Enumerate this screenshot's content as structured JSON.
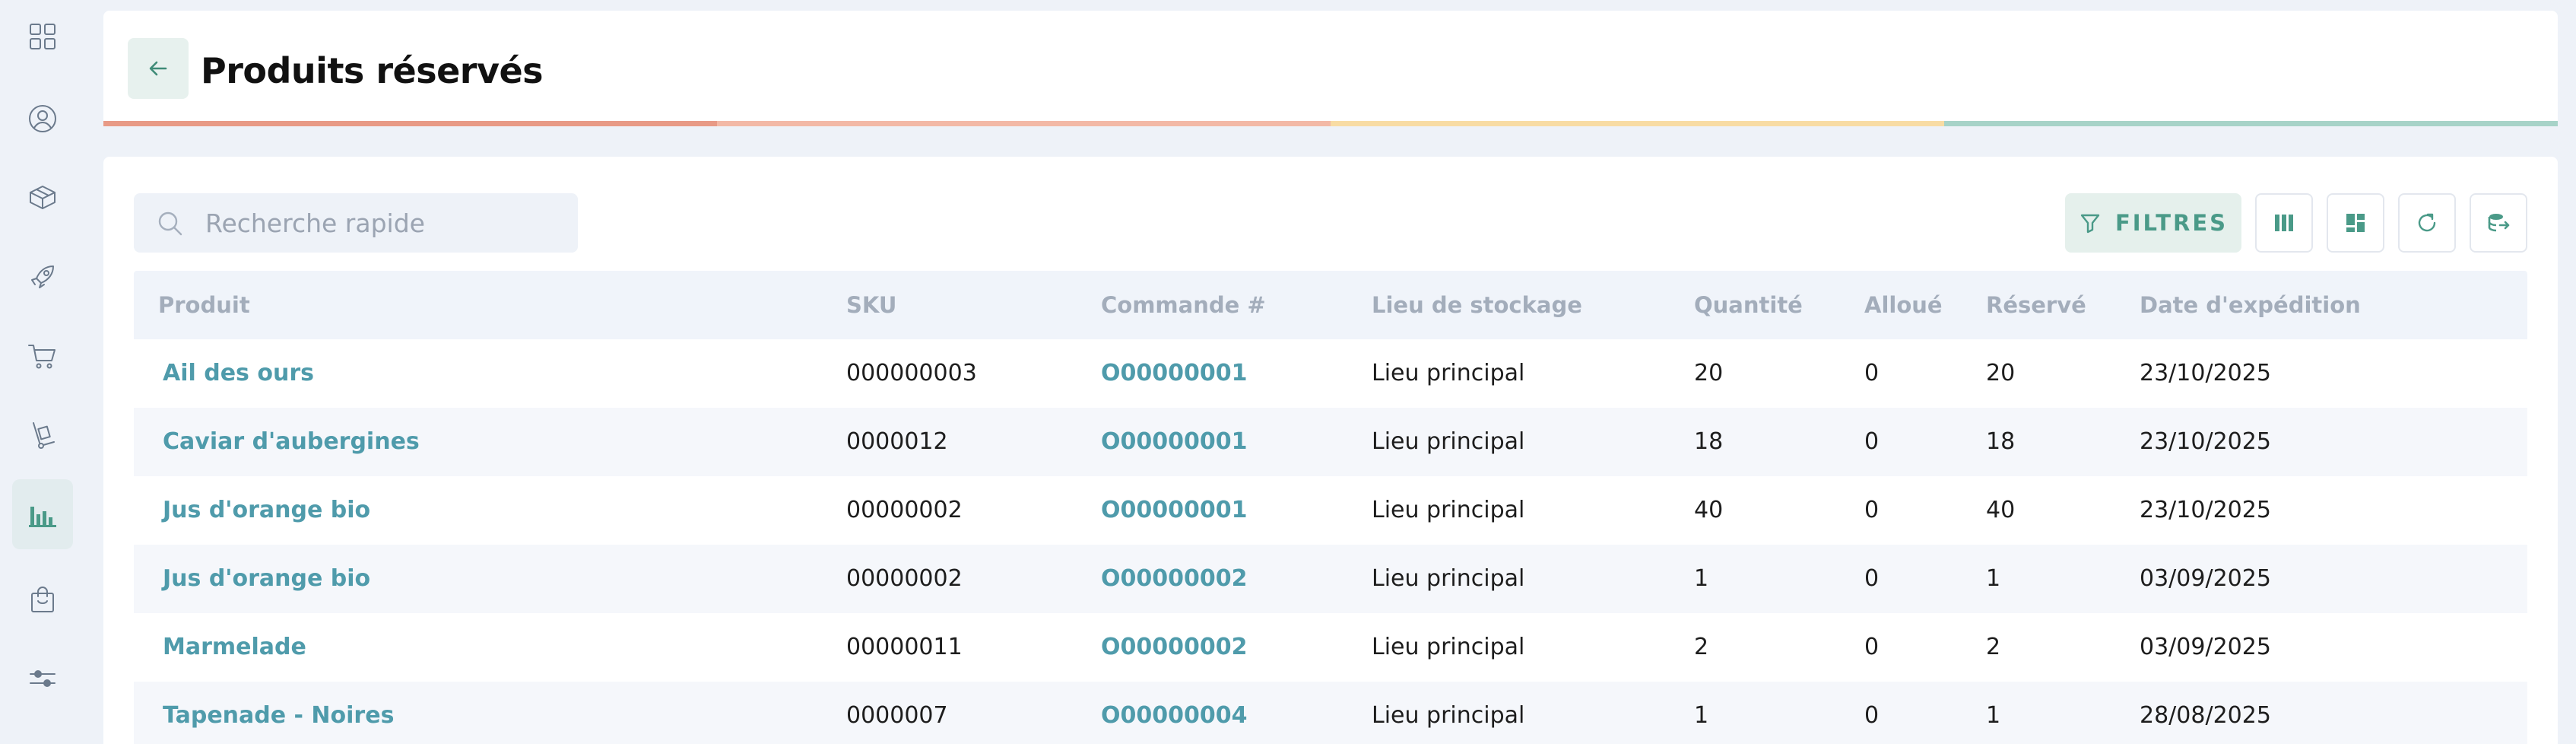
{
  "page": {
    "title": "Produits réservés"
  },
  "sidebar": {
    "items": [
      {
        "name": "dashboard",
        "icon": "grid-icon",
        "active": false
      },
      {
        "name": "contacts",
        "icon": "user-circle-icon",
        "active": false
      },
      {
        "name": "products",
        "icon": "box-icon",
        "active": false
      },
      {
        "name": "launches",
        "icon": "rocket-icon",
        "active": false
      },
      {
        "name": "purchases",
        "icon": "cart-icon",
        "active": false
      },
      {
        "name": "logistics",
        "icon": "hand-truck-icon",
        "active": false
      },
      {
        "name": "reports",
        "icon": "bar-chart-icon",
        "active": true
      },
      {
        "name": "sales",
        "icon": "shopping-bag-icon",
        "active": false
      },
      {
        "name": "settings",
        "icon": "sliders-icon",
        "active": false
      }
    ]
  },
  "progress_colors": [
    "#e89a86",
    "#f3b9a6",
    "#f8dca4",
    "#a7d3c8"
  ],
  "search": {
    "placeholder": "Recherche rapide",
    "value": ""
  },
  "toolbar": {
    "filter_label": "FILTRES"
  },
  "colors": {
    "accent": "#4a9a88",
    "link": "#4f9bab"
  },
  "table": {
    "headers": {
      "product": "Produit",
      "sku": "SKU",
      "order": "Commande #",
      "location": "Lieu de stockage",
      "quantity": "Quantité",
      "allocated": "Alloué",
      "reserved": "Réservé",
      "ship_date": "Date d'expédition"
    },
    "rows": [
      {
        "product": "Ail des ours",
        "sku": "000000003",
        "order": "O00000001",
        "location": "Lieu principal",
        "quantity": "20",
        "allocated": "0",
        "reserved": "20",
        "ship_date": "23/10/2025"
      },
      {
        "product": "Caviar d'aubergines",
        "sku": "0000012",
        "order": "O00000001",
        "location": "Lieu principal",
        "quantity": "18",
        "allocated": "0",
        "reserved": "18",
        "ship_date": "23/10/2025"
      },
      {
        "product": "Jus d'orange bio",
        "sku": "00000002",
        "order": "O00000001",
        "location": "Lieu principal",
        "quantity": "40",
        "allocated": "0",
        "reserved": "40",
        "ship_date": "23/10/2025"
      },
      {
        "product": "Jus d'orange bio",
        "sku": "00000002",
        "order": "O00000002",
        "location": "Lieu principal",
        "quantity": "1",
        "allocated": "0",
        "reserved": "1",
        "ship_date": "03/09/2025"
      },
      {
        "product": "Marmelade",
        "sku": "00000011",
        "order": "O00000002",
        "location": "Lieu principal",
        "quantity": "2",
        "allocated": "0",
        "reserved": "2",
        "ship_date": "03/09/2025"
      },
      {
        "product": "Tapenade - Noires",
        "sku": "0000007",
        "order": "O00000004",
        "location": "Lieu principal",
        "quantity": "1",
        "allocated": "0",
        "reserved": "1",
        "ship_date": "28/08/2025"
      }
    ]
  }
}
